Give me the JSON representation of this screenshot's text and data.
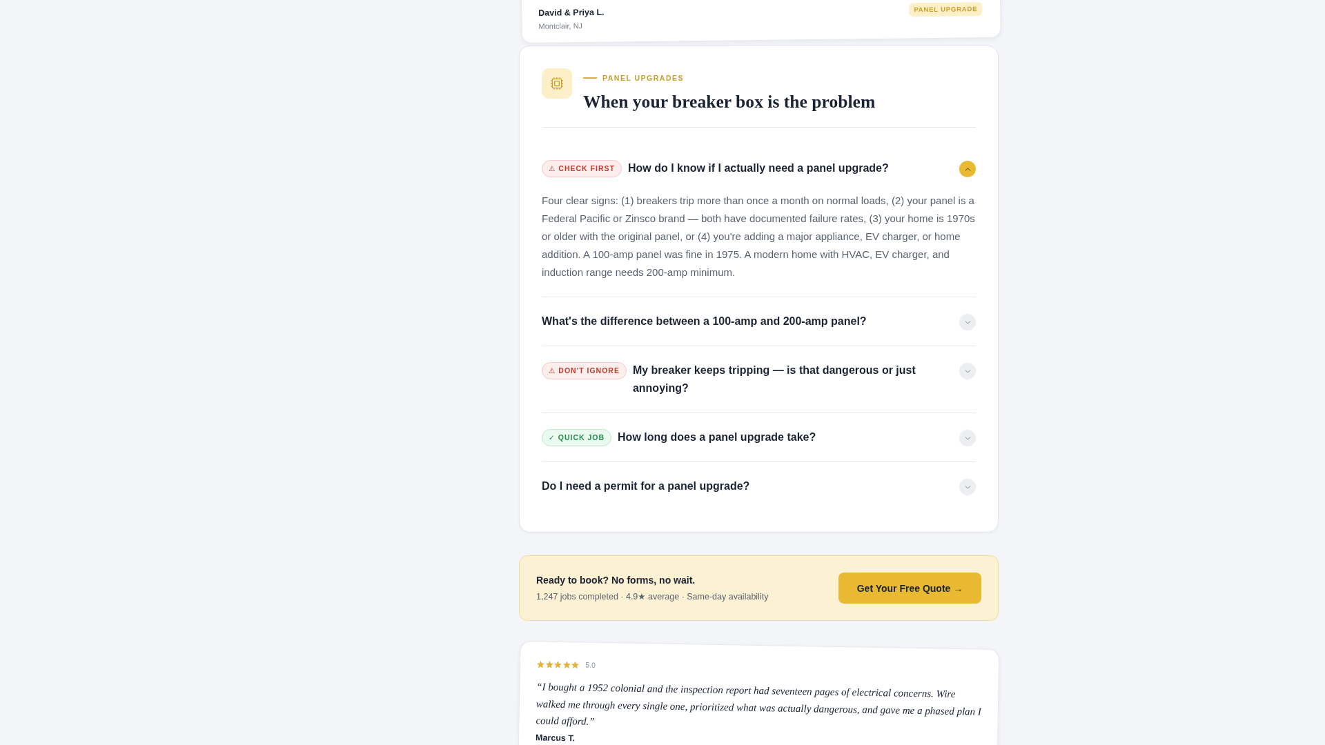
{
  "testimonial_top": {
    "name": "David & Priya L.",
    "location": "Montclair, NJ",
    "tag": "PANEL UPGRADE"
  },
  "faq_section": {
    "eyebrow": "PANEL UPGRADES",
    "title": "When your breaker box is the problem",
    "items": [
      {
        "badge": {
          "kind": "warning",
          "label": "⚠ CHECK FIRST"
        },
        "question": "How do I know if I actually need a panel upgrade?",
        "expanded": true,
        "answer": "Four clear signs: (1) breakers trip more than once a month on normal loads, (2) your panel is a Federal Pacific or Zinsco brand — both have documented failure rates, (3) your home is 1970s or older with the original panel, or (4) you're adding a major appliance, EV charger, or home addition. A 100-amp panel was fine in 1975. A modern home with HVAC, EV charger, and induction range needs 200-amp minimum."
      },
      {
        "question": "What's the difference between a 100-amp and 200-amp panel?",
        "expanded": false
      },
      {
        "badge": {
          "kind": "warning",
          "label": "⚠ DON'T IGNORE"
        },
        "question": "My breaker keeps tripping — is that dangerous or just annoying?",
        "expanded": false
      },
      {
        "badge": {
          "kind": "success",
          "label": "✓ QUICK JOB"
        },
        "question": "How long does a panel upgrade take?",
        "expanded": false
      },
      {
        "question": "Do I need a permit for a panel upgrade?",
        "expanded": false
      }
    ]
  },
  "cta": {
    "title": "Ready to book? No forms, no wait.",
    "subtitle": "1,247 jobs completed · 4.9★ average · Same-day availability",
    "button": "Get Your Free Quote →"
  },
  "testimonial_bottom": {
    "stars": 5,
    "rating": "5.0",
    "quote": "“I bought a 1952 colonial and the inspection report had seventeen pages of electrical concerns. Wire walked me through every single one, prioritized what was actually dangerous, and gave me a phased plan I could afford.”",
    "name": "Marcus T."
  }
}
